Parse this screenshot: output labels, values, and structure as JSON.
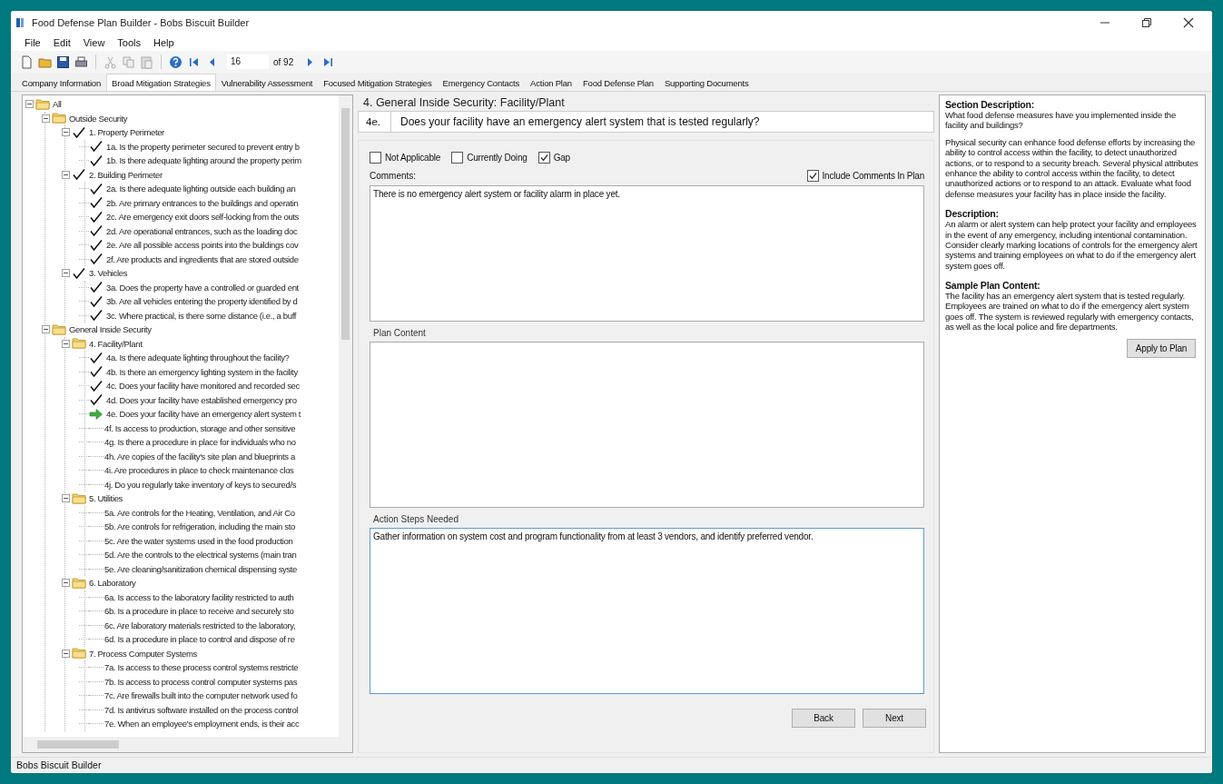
{
  "window": {
    "title": "Food Defense Plan Builder - Bobs Biscuit Builder"
  },
  "menu": [
    "File",
    "Edit",
    "View",
    "Tools",
    "Help"
  ],
  "toolbar": {
    "record": "16",
    "record_count": "of 92"
  },
  "tabs": [
    {
      "label": "Company Information",
      "selected": false
    },
    {
      "label": "Broad Mitigation Strategies",
      "selected": true
    },
    {
      "label": "Vulnerability Assessment",
      "selected": false
    },
    {
      "label": "Focused Mitigation Strategies",
      "selected": false
    },
    {
      "label": "Emergency Contacts",
      "selected": false
    },
    {
      "label": "Action Plan",
      "selected": false
    },
    {
      "label": "Food Defense Plan",
      "selected": false
    },
    {
      "label": "Supporting Documents",
      "selected": false
    }
  ],
  "tree": [
    {
      "label": "All",
      "kind": "folder",
      "expanded": true,
      "children": [
        {
          "label": "Outside Security",
          "kind": "folder",
          "expanded": true,
          "children": [
            {
              "label": "1. Property Perimeter",
              "kind": "done",
              "expanded": true,
              "children": [
                {
                  "label": "1a. Is the property perimeter secured to prevent entry b",
                  "kind": "done"
                },
                {
                  "label": "1b. Is there adequate lighting around the property perim",
                  "kind": "done"
                }
              ]
            },
            {
              "label": "2. Building Perimeter",
              "kind": "done",
              "expanded": true,
              "children": [
                {
                  "label": "2a. Is there adequate lighting outside each building an",
                  "kind": "done"
                },
                {
                  "label": "2b. Are primary entrances to the buildings and operatin",
                  "kind": "done"
                },
                {
                  "label": "2c. Are emergency exit doors self-locking from the outs",
                  "kind": "done"
                },
                {
                  "label": "2d. Are operational entrances, such as the loading doc",
                  "kind": "done"
                },
                {
                  "label": "2e. Are all possible access points into the buildings cov",
                  "kind": "done"
                },
                {
                  "label": "2f. Are products and ingredients that are stored outside",
                  "kind": "done"
                }
              ]
            },
            {
              "label": "3. Vehicles",
              "kind": "done",
              "expanded": true,
              "children": [
                {
                  "label": "3a. Does the property have a controlled or guarded ent",
                  "kind": "done"
                },
                {
                  "label": "3b. Are all vehicles entering the property identified by d",
                  "kind": "done"
                },
                {
                  "label": "3c. Where practical, is there some distance (i.e., a buff",
                  "kind": "done"
                }
              ]
            }
          ]
        },
        {
          "label": "General Inside Security",
          "kind": "folder",
          "expanded": true,
          "children": [
            {
              "label": "4. Facility/Plant",
              "kind": "folder",
              "expanded": true,
              "children": [
                {
                  "label": "4a. Is there adequate lighting throughout the facility?",
                  "kind": "done"
                },
                {
                  "label": "4b. Is there an emergency lighting system in the facility",
                  "kind": "done"
                },
                {
                  "label": "4c. Does your facility have monitored and recorded sec",
                  "kind": "done"
                },
                {
                  "label": "4d. Does your facility have established emergency pro",
                  "kind": "done"
                },
                {
                  "label": "4e. Does your facility have an emergency alert system t",
                  "kind": "current"
                },
                {
                  "label": "4f. Is access to production, storage and other sensitive",
                  "kind": "pending"
                },
                {
                  "label": "4g. Is there a procedure in place for individuals who no",
                  "kind": "pending"
                },
                {
                  "label": "4h. Are copies of the facility's site plan and blueprints a",
                  "kind": "pending"
                },
                {
                  "label": "4i. Are procedures in place to check maintenance clos",
                  "kind": "pending"
                },
                {
                  "label": "4j. Do you regularly take inventory of keys to secured/s",
                  "kind": "pending"
                }
              ]
            },
            {
              "label": "5. Utilities",
              "kind": "folder",
              "expanded": true,
              "children": [
                {
                  "label": "5a. Are controls for the Heating, Ventilation, and Air Co",
                  "kind": "pending"
                },
                {
                  "label": "5b. Are controls for refrigeration, including the main sto",
                  "kind": "pending"
                },
                {
                  "label": "5c. Are the water systems used in the food production",
                  "kind": "pending"
                },
                {
                  "label": "5d. Are the controls to the electrical systems (main tran",
                  "kind": "pending"
                },
                {
                  "label": "5e. Are cleaning/sanitization chemical dispensing syste",
                  "kind": "pending"
                }
              ]
            },
            {
              "label": "6. Laboratory",
              "kind": "folder",
              "expanded": true,
              "children": [
                {
                  "label": "6a. Is access to the laboratory facility restricted to auth",
                  "kind": "pending"
                },
                {
                  "label": "6b. Is a procedure in place to receive and securely sto",
                  "kind": "pending"
                },
                {
                  "label": "6c. Are laboratory materials restricted to the laboratory,",
                  "kind": "pending"
                },
                {
                  "label": "6d. Is a procedure in place to control and dispose of re",
                  "kind": "pending"
                }
              ]
            },
            {
              "label": "7. Process Computer Systems",
              "kind": "folder",
              "expanded": true,
              "children": [
                {
                  "label": "7a. Is access to these process control systems restricte",
                  "kind": "pending"
                },
                {
                  "label": "7b. Is access to process control computer systems pas",
                  "kind": "pending"
                },
                {
                  "label": "7c. Are firewalls built into the computer network used fo",
                  "kind": "pending"
                },
                {
                  "label": "7d. Is antivirus software installed on the process control",
                  "kind": "pending"
                },
                {
                  "label": "7e. When an employee's employment ends, is their acc",
                  "kind": "pending"
                }
              ]
            }
          ]
        }
      ]
    }
  ],
  "question": {
    "section": "4. General Inside Security: Facility/Plant",
    "number": "4e.",
    "text": "Does your facility have an emergency alert system that is tested regularly?"
  },
  "options": [
    {
      "label": "Not Applicable",
      "checked": false
    },
    {
      "label": "Currently Doing",
      "checked": false
    },
    {
      "label": "Gap",
      "checked": true
    }
  ],
  "comments": {
    "label": "Comments:",
    "include_label": "Include Comments In Plan",
    "include_checked": true,
    "value": "There is no emergency alert system or facility alarm in place yet."
  },
  "plan_content": {
    "label": "Plan Content"
  },
  "action_steps": {
    "label": "Action Steps Needed",
    "value": "Gather information on system cost and program functionality from at least 3 vendors, and identify preferred vendor."
  },
  "buttons": [
    "Back",
    "Next"
  ],
  "description": [
    {
      "heading": "Section Description:",
      "paragraphs": [
        "What food defense measures have you implemented inside the facility and buildings?",
        "Physical security can enhance food defense efforts by increasing the ability to control access within the facility, to detect unauthorized actions, or to respond to a security breach.  Several physical attributes enhance the ability to control access within the facility, to detect unauthorized actions or to respond to an attack.  Evaluate what food defense measures your facility has in place inside the facility."
      ]
    },
    {
      "heading": "Description:",
      "paragraphs": [
        "An alarm or alert system can help protect your facility and employees in the event of any emergency, including intentional contamination.  Consider clearly marking locations of controls for the emergency alert systems and training employees on what to do if the emergency alert system goes off."
      ]
    },
    {
      "heading": "Sample Plan Content:",
      "paragraphs": [
        "The facility has an emergency alert system that is tested regularly.  Employees are trained on what to do if the emergency alert system goes off.  The system is reviewed regularly with emergency contacts, as well as the local police and fire departments."
      ]
    }
  ],
  "apply_button": "Apply to Plan",
  "status_bar": "Bobs Biscuit Builder"
}
